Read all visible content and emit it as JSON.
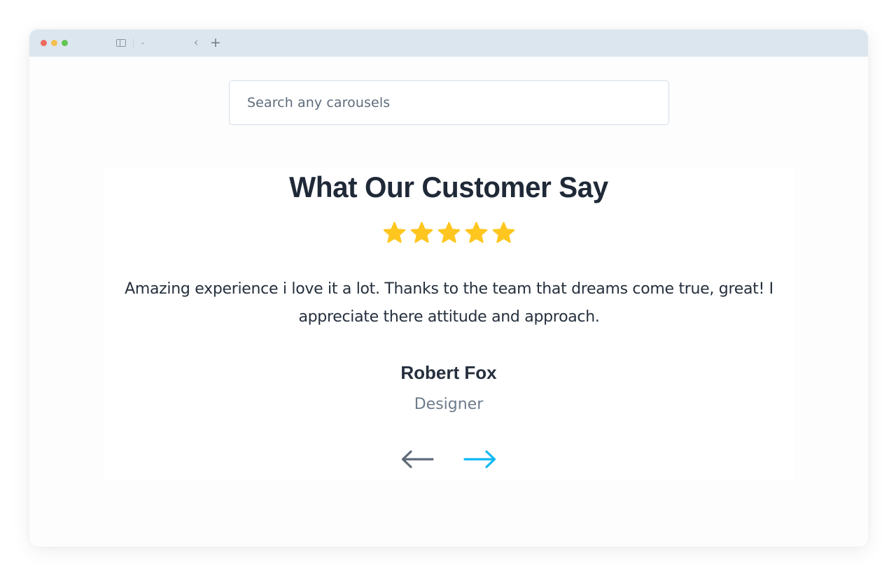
{
  "browser": {
    "traffic_lights": [
      "close",
      "minimize",
      "maximize"
    ],
    "icons": {
      "sidebar": "sidebar-icon",
      "dropdown": "chevron-down-icon",
      "back": "chevron-left-icon",
      "new_tab": "plus-icon"
    },
    "chevron_glyph": "⌄",
    "back_glyph": "‹",
    "plus_glyph": "+"
  },
  "search": {
    "placeholder": "Search any carousels",
    "value": ""
  },
  "testimonial": {
    "heading": "What Our Customer Say",
    "rating": 5,
    "rating_max": 5,
    "quote": "Amazing experience i love it a lot. Thanks to the team that dreams come true, great! I appreciate there attitude and approach.",
    "author": "Robert Fox",
    "role": "Designer"
  },
  "navigation": {
    "prev_icon": "arrow-left-icon",
    "next_icon": "arrow-right-icon"
  },
  "colors": {
    "toolbar": "#dce6ef",
    "star": "#fec61f",
    "heading": "#1f2937",
    "text": "#252f3d",
    "muted": "#6d7b8b",
    "arrow_prev": "#5f6b79",
    "arrow_next": "#0fb8f2"
  }
}
